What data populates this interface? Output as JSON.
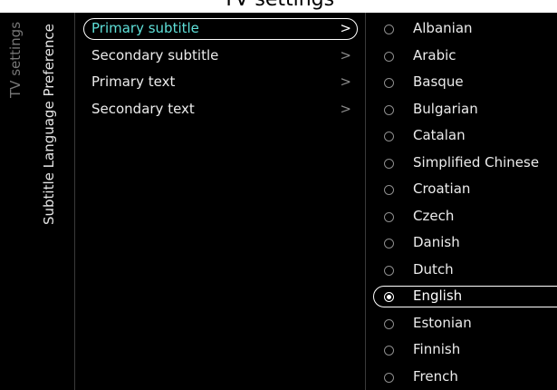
{
  "header": {
    "title": "TV settings"
  },
  "breadcrumb": {
    "root": "TV settings",
    "section": "Subtitle Language Preference"
  },
  "menu": {
    "items": [
      {
        "label": "Primary subtitle",
        "selected": true
      },
      {
        "label": "Secondary subtitle",
        "selected": false
      },
      {
        "label": "Primary text",
        "selected": false
      },
      {
        "label": "Secondary text",
        "selected": false
      }
    ]
  },
  "languages": {
    "selected": "English",
    "options": [
      "Albanian",
      "Arabic",
      "Basque",
      "Bulgarian",
      "Catalan",
      "Simplified Chinese",
      "Croatian",
      "Czech",
      "Danish",
      "Dutch",
      "English",
      "Estonian",
      "Finnish",
      "French"
    ]
  },
  "colors": {
    "accent": "#5fe0d9",
    "background": "#000000",
    "text": "#ececec"
  }
}
